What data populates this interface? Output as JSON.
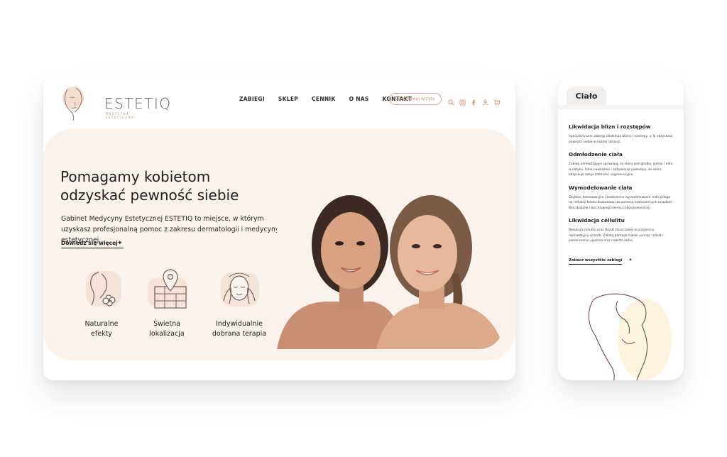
{
  "brand": {
    "name": "ESTETIQ",
    "tagline": "MEDYCYNA ESTETYCZNA"
  },
  "nav": {
    "items": [
      "ZABIEGI",
      "SKLEP",
      "CENNIK",
      "O NAS",
      "KONTAKT"
    ],
    "cta": "Zarezerwuj wizytę"
  },
  "header_icons": [
    "search-icon",
    "instagram-icon",
    "facebook-icon",
    "user-icon",
    "cart-icon"
  ],
  "hero": {
    "title_line1": "Pomagamy kobietom",
    "title_line2": "odzyskać pewność siebie",
    "lead": "Gabinet Medycyny Estetycznej ESTETIQ to miejsce, w którym uzyskasz profesjonalną pomoc z zakresu dermatologii i medycyny estetycznej.",
    "more": "Dowiedz się więcej"
  },
  "features": [
    {
      "icon": "woman-flower-icon",
      "line1": "Naturalne",
      "line2": "efekty"
    },
    {
      "icon": "map-pin-icon",
      "line1": "Świetna",
      "line2": "lokalizacja"
    },
    {
      "icon": "face-massage-icon",
      "line1": "Indywidualnie",
      "line2": "dobrana terapia"
    }
  ],
  "mobile": {
    "tab": "Ciało",
    "sections": [
      {
        "title": "Likwidacja blizn i rozstępów",
        "text": "Specjalistyczne zabiegi zlikwidują blizny i rozstępy, a Ty odzyskasz pewność siebie w każdej sytuacji."
      },
      {
        "title": "Odmłodzenie ciała",
        "text": "Zabieg odmładzające sprawiają, że skóra jest gładka, jędrna i miła w dotyku. Silne nawilżenie i odżywienie powoduje, że skóra odzyskuje swoje zdolności regeneracyjne."
      },
      {
        "title": "Wymodelowanie ciała",
        "text": "Szybkie, bezinwazyjne i bezbolesne wymodelowanie ciała polega na redukcji tkanki tłuszczowej za pomocą nowoczesnych urządzeń. Bez skalpela i bez długiego okresu rekonwalescencji."
      },
      {
        "title": "Likwidacja cellulitu",
        "text": "Redukcja cellulitu oraz tkanki tłuszczowej w przyjemny, nieinwazyjny sposób. Zabieg pomaga trwale usunąć cellulit i jednocześnie ujędrnia oraz nawilża skórę."
      }
    ],
    "link": "Zobacz wszystkie zabiegi"
  }
}
